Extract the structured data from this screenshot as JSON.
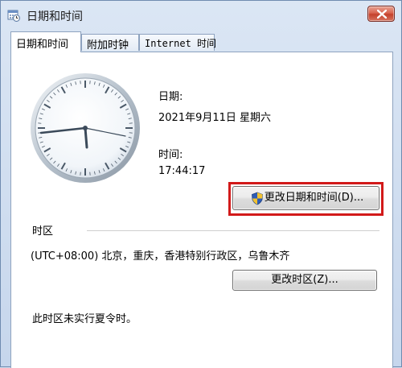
{
  "window": {
    "title": "日期和时间"
  },
  "tabs": [
    {
      "label": "日期和时间"
    },
    {
      "label": "附加时钟"
    },
    {
      "label": "Internet 时间"
    }
  ],
  "date": {
    "label": "日期:",
    "value": "2021年9月11日 星期六"
  },
  "time": {
    "label": "时间:",
    "value": "17:44:17"
  },
  "buttons": {
    "change_datetime": "更改日期和时间(D)...",
    "change_timezone": "更改时区(Z)..."
  },
  "timezone": {
    "label": "时区",
    "value": "(UTC+08:00) 北京，重庆，香港特别行政区，乌鲁木齐"
  },
  "dst_note": "此时区未实行夏令时。",
  "colors": {
    "highlight": "#d21a1a",
    "close_button": "#c4412b"
  },
  "icons": {
    "window": "calendar-clock-icon",
    "close": "close-icon",
    "uac": "uac-shield-icon"
  }
}
